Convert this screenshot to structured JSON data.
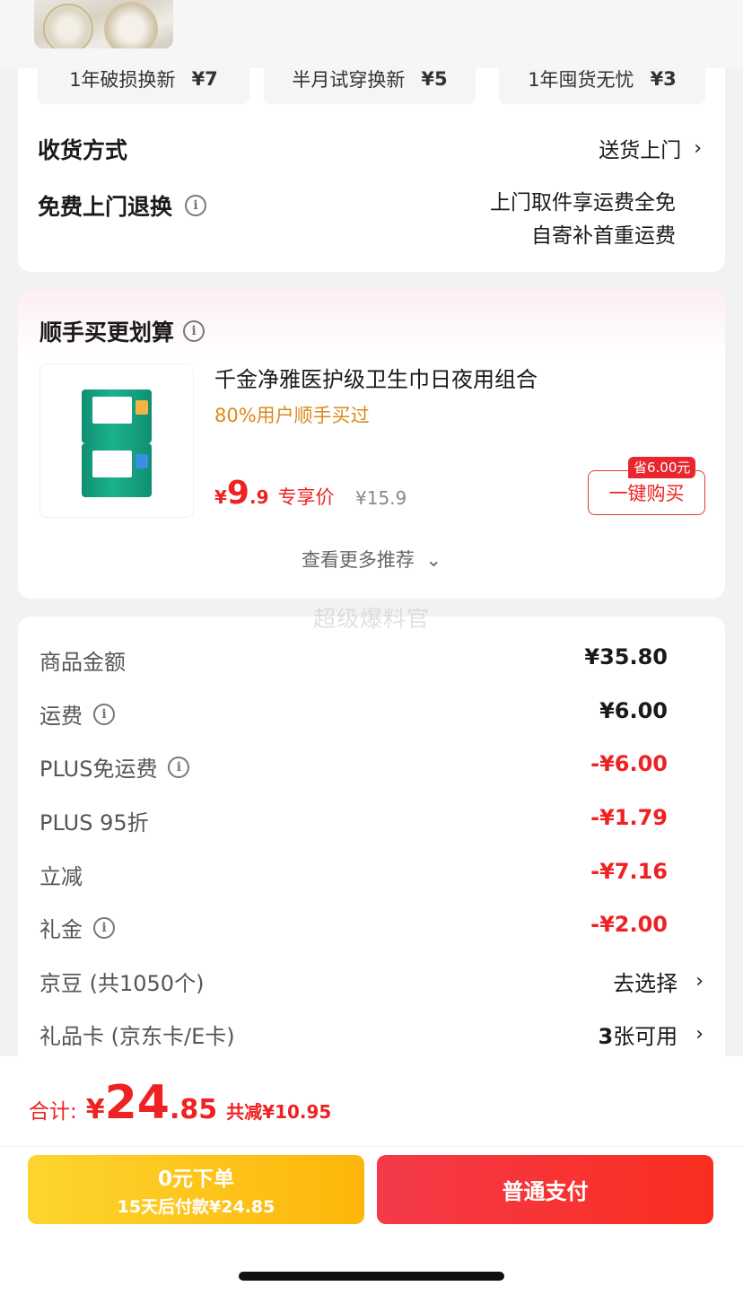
{
  "services": [
    {
      "label": "1年破损换新",
      "price": "¥7"
    },
    {
      "label": "半月试穿换新",
      "price": "¥5"
    },
    {
      "label": "1年囤货无忧",
      "price": "¥3"
    }
  ],
  "delivery": {
    "label": "收货方式",
    "value": "送货上门"
  },
  "free_return": {
    "label": "免费上门退换",
    "line1": "上门取件享运费全免",
    "line2": "自寄补首重运费"
  },
  "recommend": {
    "title": "顺手买更划算",
    "product_name": "千金净雅医护级卫生巾日夜用组合",
    "bought_stat": "80%用户顺手买过",
    "price_yen": "¥",
    "price_int": "9",
    "price_dec": ".9",
    "price_tag": "专享价",
    "original_price": "¥15.9",
    "save_tag": "省6.00元",
    "buy_button": "一键购买",
    "more_link": "查看更多推荐"
  },
  "watermark": "超级爆料官",
  "amounts": [
    {
      "label": "商品金额",
      "value": "¥35.80",
      "info": false,
      "red": false
    },
    {
      "label": "运费",
      "value": "¥6.00",
      "info": true,
      "red": false
    },
    {
      "label": "PLUS免运费",
      "value": "-¥6.00",
      "info": true,
      "red": true
    },
    {
      "label": "PLUS 95折",
      "value": "-¥1.79",
      "info": false,
      "red": true
    },
    {
      "label": "立减",
      "value": "-¥7.16",
      "info": false,
      "red": true
    },
    {
      "label": "礼金",
      "value": "-¥2.00",
      "info": true,
      "red": true
    }
  ],
  "jingdou": {
    "label": "京豆 (共1050个)",
    "value": "去选择"
  },
  "giftcard": {
    "label": "礼品卡 (京东卡/E卡)",
    "count": "3",
    "value_suffix": "张可用"
  },
  "total": {
    "label": "合计:",
    "yen": "¥",
    "int": "24",
    "dec": ".85",
    "saved": "共减¥10.95"
  },
  "buttons": {
    "zero_title": "0元下单",
    "zero_sub": "15天后付款¥24.85",
    "pay": "普通支付"
  },
  "colors": {
    "accent_red": "#e22222",
    "yellow_start": "#fdd52e",
    "yellow_end": "#fdb60b",
    "orange_text": "#d98a1a"
  }
}
